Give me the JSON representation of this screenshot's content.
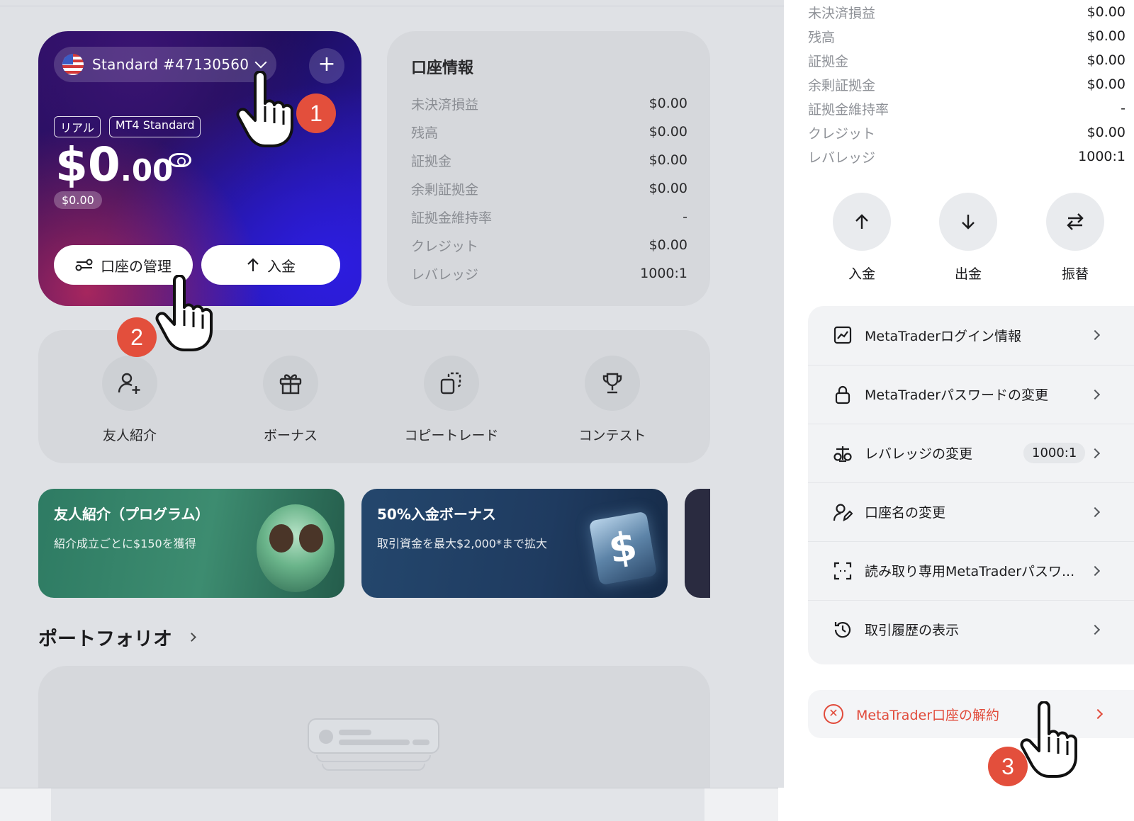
{
  "account_card": {
    "account_name": "Standard #47130560",
    "tags": [
      "リアル",
      "MT4 Standard"
    ],
    "balance_main": "$0",
    "balance_decimal": ".00",
    "sub_balance": "$0.00",
    "manage_label": "口座の管理",
    "deposit_label": "入金"
  },
  "account_info": {
    "title": "口座情報",
    "rows": [
      {
        "label": "未決済損益",
        "value": "$0.00"
      },
      {
        "label": "残高",
        "value": "$0.00"
      },
      {
        "label": "証拠金",
        "value": "$0.00"
      },
      {
        "label": "余剰証拠金",
        "value": "$0.00"
      },
      {
        "label": "証拠金維持率",
        "value": "-"
      },
      {
        "label": "クレジット",
        "value": "$0.00"
      },
      {
        "label": "レバレッジ",
        "value": "1000:1"
      }
    ]
  },
  "quick_actions": [
    {
      "label": "友人紹介",
      "icon": "user-plus-icon"
    },
    {
      "label": "ボーナス",
      "icon": "gift-icon"
    },
    {
      "label": "コピートレード",
      "icon": "copy-icon"
    },
    {
      "label": "コンテスト",
      "icon": "trophy-icon"
    }
  ],
  "promos": [
    {
      "title": "友人紹介（プログラム）",
      "subtitle": "紹介成立ごとに$150を獲得"
    },
    {
      "title": "50%入金ボーナス",
      "subtitle": "取引資金を最大$2,000*まで拡大"
    }
  ],
  "portfolio": {
    "title": "ポートフォリオ"
  },
  "right_panel": {
    "rows": [
      {
        "label": "未決済損益",
        "value": "$0.00"
      },
      {
        "label": "残高",
        "value": "$0.00"
      },
      {
        "label": "証拠金",
        "value": "$0.00"
      },
      {
        "label": "余剰証拠金",
        "value": "$0.00"
      },
      {
        "label": "証拠金維持率",
        "value": "-"
      },
      {
        "label": "クレジット",
        "value": "$0.00"
      },
      {
        "label": "レバレッジ",
        "value": "1000:1"
      }
    ],
    "actions": [
      {
        "label": "入金",
        "icon": "arrow-up-icon"
      },
      {
        "label": "出金",
        "icon": "arrow-down-icon"
      },
      {
        "label": "振替",
        "icon": "transfer-icon"
      }
    ],
    "menu": [
      {
        "label": "MetaTraderログイン情報",
        "icon": "chart-icon"
      },
      {
        "label": "MetaTraderパスワードの変更",
        "icon": "lock-icon"
      },
      {
        "label": "レバレッジの変更",
        "icon": "scale-icon",
        "badge": "1000:1"
      },
      {
        "label": "口座名の変更",
        "icon": "user-edit-icon"
      },
      {
        "label": "読み取り専用MetaTraderパスワ...",
        "icon": "scan-icon"
      },
      {
        "label": "取引履歴の表示",
        "icon": "history-icon"
      }
    ],
    "close_account_label": "MetaTrader口座の解約"
  },
  "step_markers": [
    "1",
    "2",
    "3"
  ],
  "colors": {
    "danger": "#e14b3b",
    "marker": "#e34f3c",
    "card_gradient_start": "#2b0e63",
    "card_gradient_end": "#2b1ac4"
  }
}
